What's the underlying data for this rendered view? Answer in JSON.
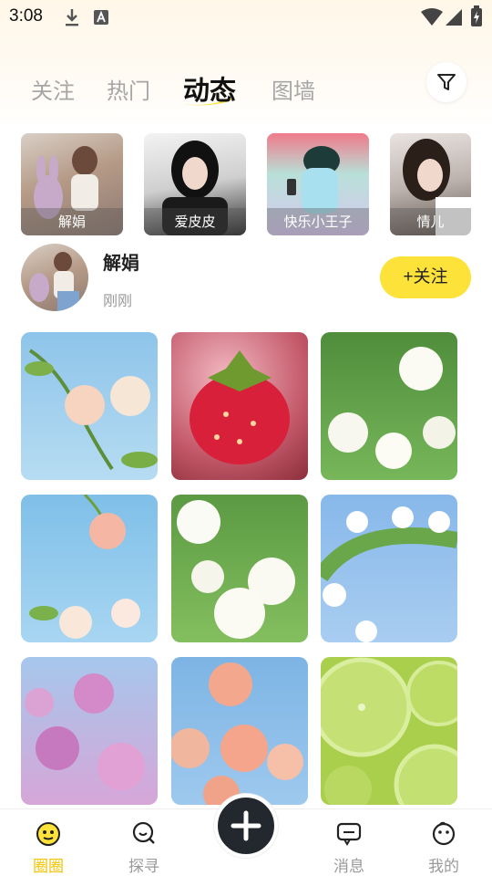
{
  "status_bar": {
    "time": "3:08"
  },
  "tabs": [
    {
      "label": "关注",
      "active": false
    },
    {
      "label": "热门",
      "active": false
    },
    {
      "label": "动态",
      "active": true
    },
    {
      "label": "图墙",
      "active": false
    }
  ],
  "stories": [
    {
      "name": "解娟"
    },
    {
      "name": "爱皮皮"
    },
    {
      "name": "快乐小王子"
    },
    {
      "name": "情儿"
    }
  ],
  "post": {
    "username": "解娟",
    "time": "刚刚",
    "follow_label": "+关注",
    "images": [
      "rose-sky",
      "strawberry",
      "white-roses",
      "pink-rose-sky",
      "white-flowers",
      "white-rose-arch",
      "purple-roses",
      "pink-roses",
      "lime-slices"
    ]
  },
  "bottom_nav": {
    "items": [
      {
        "label": "圈圈",
        "icon": "circle-face-icon",
        "active": true
      },
      {
        "label": "探寻",
        "icon": "search-icon",
        "active": false
      },
      {
        "label": "消息",
        "icon": "message-icon",
        "active": false
      },
      {
        "label": "我的",
        "icon": "profile-face-icon",
        "active": false
      }
    ],
    "fab_icon": "plus-icon"
  },
  "colors": {
    "accent": "#fde23a",
    "active_nav": "#f2c400",
    "fab": "#23282f"
  }
}
